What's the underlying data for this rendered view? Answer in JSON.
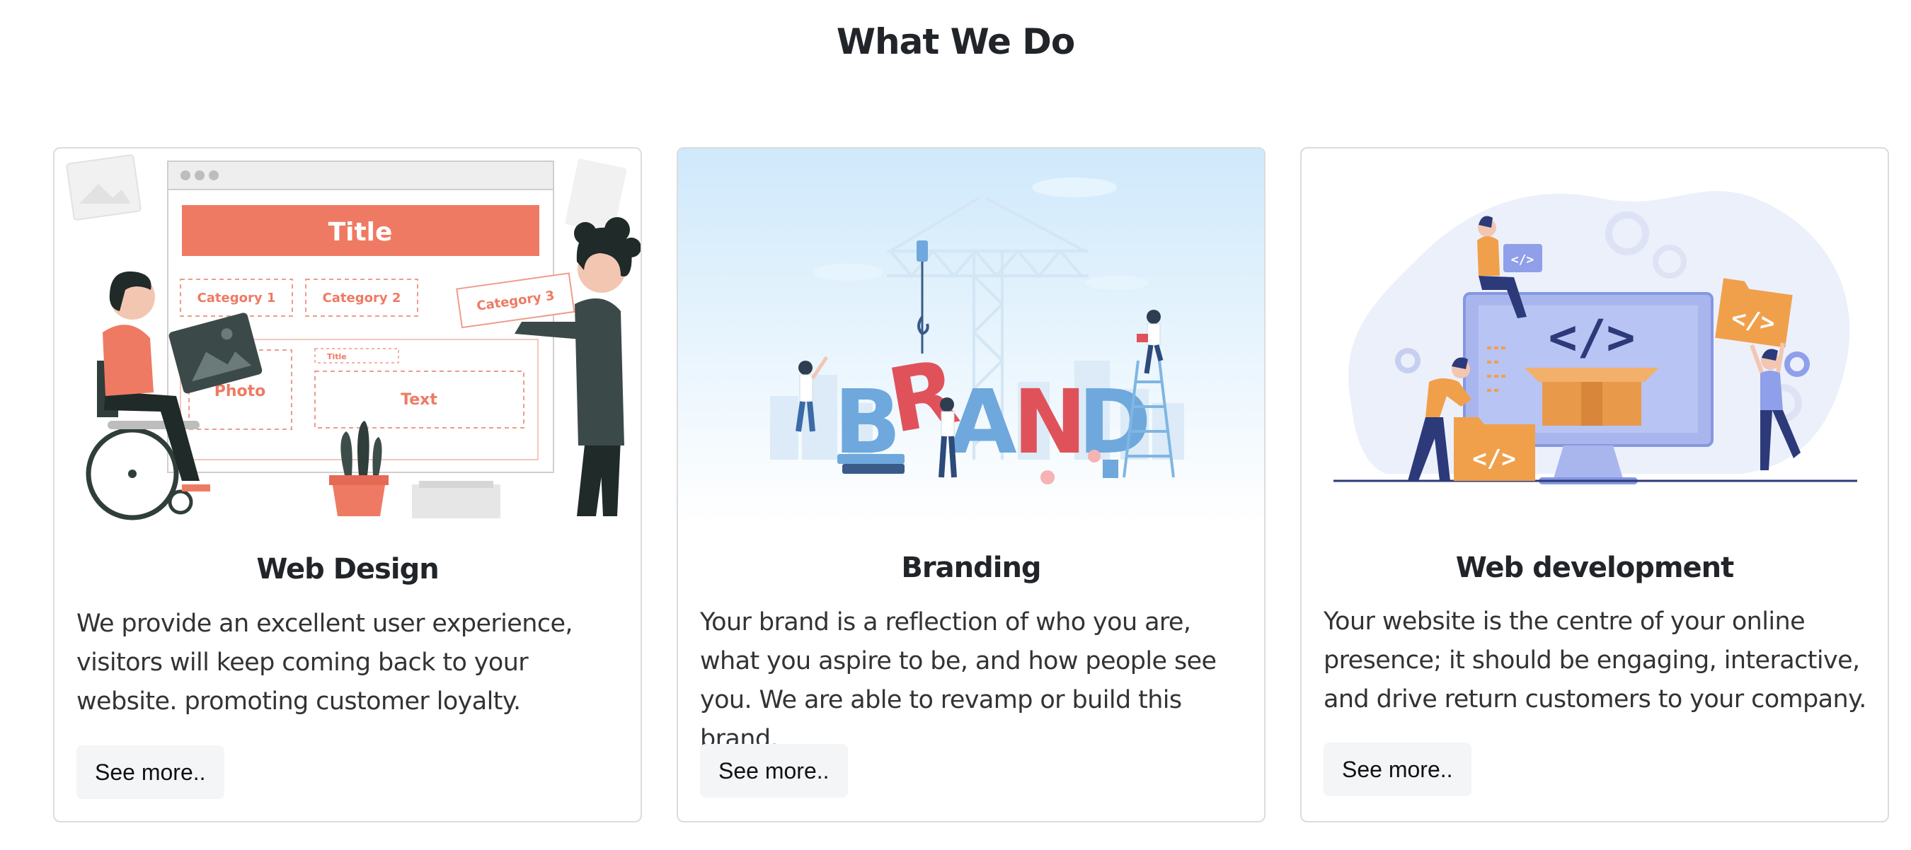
{
  "section": {
    "title": "What We Do"
  },
  "cards": [
    {
      "title": "Web Design",
      "text": "We provide an excellent user experience, visitors will keep coming back to your website. promoting customer loyalty.",
      "button": "See more..",
      "illustration": {
        "banner": "Title",
        "category1": "Category 1",
        "category2": "Category 2",
        "category3": "Category 3",
        "small_title": "Title",
        "photo": "Photo",
        "text": "Text"
      }
    },
    {
      "title": "Branding",
      "text": "Your brand is a reflection of who you are, what you aspire to be, and how people see you. We are able to revamp or build this brand.",
      "button": "See more..",
      "illustration": {
        "letters": [
          "B",
          "R",
          "A",
          "N",
          "D"
        ]
      }
    },
    {
      "title": "Web development",
      "text": "Your website is the centre of your online presence; it should be engaging, interactive, and drive return customers to your company.",
      "button": "See more..",
      "illustration": {
        "code_glyph": "</>"
      }
    }
  ],
  "colors": {
    "coral": "#ef7a63",
    "blue": "#6fa8dc",
    "red": "#e0525a",
    "orange": "#f0a04b",
    "indigo": "#3a4a9a"
  }
}
